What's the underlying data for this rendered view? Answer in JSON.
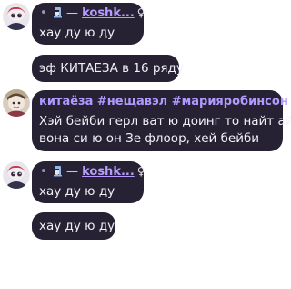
{
  "messages": [
    {
      "author": "koshk...",
      "author_prefix": "— ",
      "author_icons": [
        "stand-mixer-icon",
        "female-sign-icon"
      ],
      "text": "хау ду ю ду"
    },
    {
      "text": "эф КИТАЕЗА в 16 ряду"
    },
    {
      "author": "китаёза #нещавэл #марияробинсон",
      "text_line1": "Хэй бейби герл ват ю доинг то найт ай",
      "text_line2": "вона си ю он Зе флоор, хей бейби"
    },
    {
      "author": "koshk...",
      "author_prefix": "— ",
      "author_icons": [
        "stand-mixer-icon",
        "female-sign-icon"
      ],
      "text": "хау ду ю ду"
    },
    {
      "text": "хау ду ю ду"
    }
  ],
  "colors": {
    "bubble_bg": "#262233",
    "name_color": "#b79bff",
    "text_color": "#f2f0f6"
  }
}
